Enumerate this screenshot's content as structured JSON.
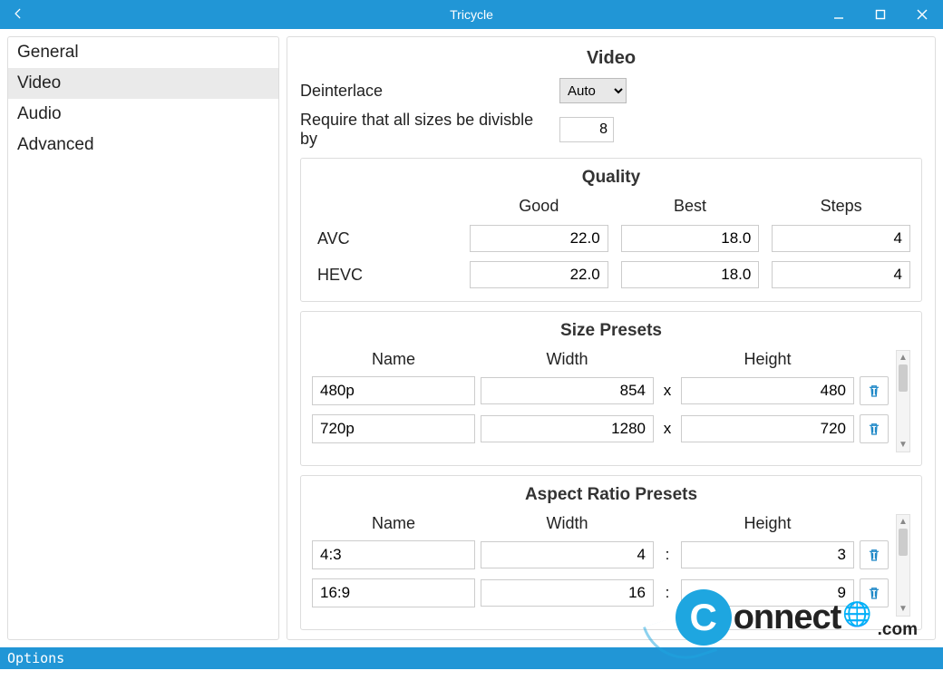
{
  "titlebar": {
    "title": "Tricycle"
  },
  "sidebar": {
    "items": [
      {
        "label": "General"
      },
      {
        "label": "Video"
      },
      {
        "label": "Audio"
      },
      {
        "label": "Advanced"
      }
    ],
    "selected_index": 1
  },
  "main": {
    "title": "Video",
    "deinterlace_label": "Deinterlace",
    "deinterlace_value": "Auto",
    "divisible_label": "Require that all sizes be divisble by",
    "divisible_value": "8",
    "quality": {
      "title": "Quality",
      "headers": {
        "good": "Good",
        "best": "Best",
        "steps": "Steps"
      },
      "rows": [
        {
          "codec": "AVC",
          "good": "22.0",
          "best": "18.0",
          "steps": "4"
        },
        {
          "codec": "HEVC",
          "good": "22.0",
          "best": "18.0",
          "steps": "4"
        }
      ]
    },
    "size_presets": {
      "title": "Size Presets",
      "headers": {
        "name": "Name",
        "width": "Width",
        "height": "Height"
      },
      "sep": "x",
      "rows": [
        {
          "name": "480p",
          "width": "854",
          "height": "480"
        },
        {
          "name": "720p",
          "width": "1280",
          "height": "720"
        }
      ]
    },
    "aspect_presets": {
      "title": "Aspect Ratio Presets",
      "headers": {
        "name": "Name",
        "width": "Width",
        "height": "Height"
      },
      "sep": ":",
      "rows": [
        {
          "name": "4:3",
          "width": "4",
          "height": "3"
        },
        {
          "name": "16:9",
          "width": "16",
          "height": "9"
        }
      ]
    }
  },
  "statusbar": {
    "label": "Options"
  },
  "watermark": {
    "brand_c": "C",
    "brand_rest": "onnect",
    "globe": "🌐",
    "com": ".com"
  }
}
